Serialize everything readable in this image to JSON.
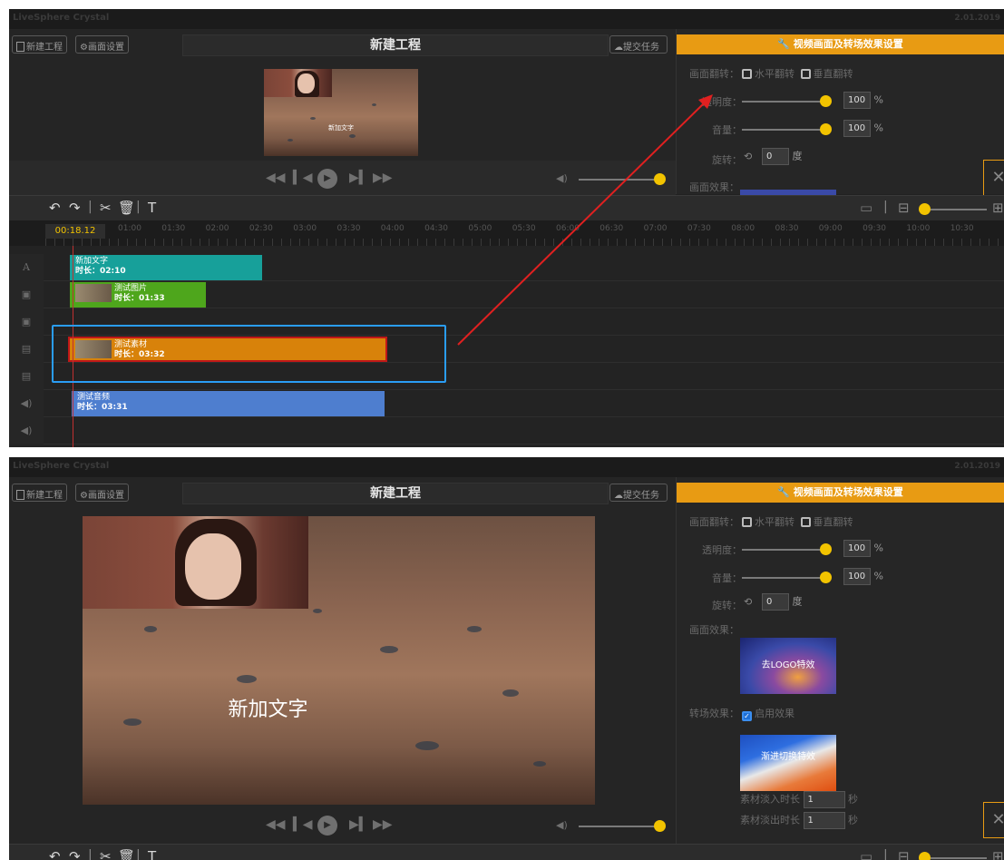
{
  "app": {
    "title": "LiveSphere Crystal",
    "title_right": "2.01.2019"
  },
  "header": {
    "new_project": "新建工程",
    "canvas_settings": "画面设置",
    "project_title": "新建工程",
    "submit": "提交任务"
  },
  "settings": {
    "panel_title": "视频画面及转场效果设置",
    "flip_label": "画面翻转：",
    "flip_h": "水平翻转",
    "flip_v": "垂直翻转",
    "opacity_label": "透明度：",
    "opacity_value": "100",
    "volume_label": "音量：",
    "volume_value": "100",
    "percent": "%",
    "rotate_label": "旋转：",
    "rotate_value": "0",
    "degree": "度",
    "effect_label": "画面效果：",
    "effect_name": "去LOGO特效",
    "transition_label": "转场效果：",
    "transition_enable": "启用效果",
    "transition_name": "渐进切换特效",
    "fade_in_label": "素材淡入时长",
    "fade_in_value": "1",
    "fade_out_label": "素材淡出时长",
    "fade_out_value": "1",
    "seconds": "秒",
    "opacity_level": 1.0,
    "volume_level": 1.0
  },
  "preview": {
    "overlay_text": "新加文字"
  },
  "timeline": {
    "current_time": "00:18.12",
    "ticks": [
      "01:00",
      "01:30",
      "02:00",
      "02:30",
      "03:00",
      "03:30",
      "04:00",
      "04:30",
      "05:00",
      "05:30",
      "06:00",
      "06:30",
      "07:00",
      "07:30",
      "08:00",
      "08:30",
      "09:00",
      "09:30",
      "10:00",
      "10:30"
    ],
    "clips": {
      "text": {
        "name": "新加文字",
        "duration": "时长：02:10"
      },
      "image": {
        "name": "测试图片",
        "duration": "时长：01:33"
      },
      "video": {
        "name": "测试素材",
        "duration": "时长：03:32"
      },
      "audio": {
        "name": "测试音频",
        "duration": "时长：03:31"
      }
    }
  },
  "colors": {
    "accent": "#e89b13",
    "text_clip": "#17a09a",
    "image_clip": "#4ea61c",
    "video_clip": "#d8820a",
    "audio_clip": "#4e7ecf",
    "annotation": "#2a9df4",
    "arrow": "#e02020"
  }
}
